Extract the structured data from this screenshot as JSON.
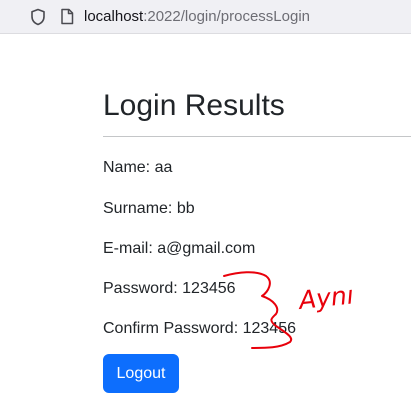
{
  "browser": {
    "url_host": "localhost",
    "url_path": ":2022/login/processLogin"
  },
  "page": {
    "title": "Login Results",
    "fields": {
      "name": "Name: aa",
      "surname": "Surname: bb",
      "email": "E-mail: a@gmail.com",
      "password": "Password: 123456",
      "confirm_password": "Confirm Password: 123456"
    },
    "logout_label": "Logout"
  },
  "annotation": {
    "text": "Aynı",
    "color": "#e8000b"
  },
  "colors": {
    "button": "#0d6efd",
    "text": "#212529"
  }
}
